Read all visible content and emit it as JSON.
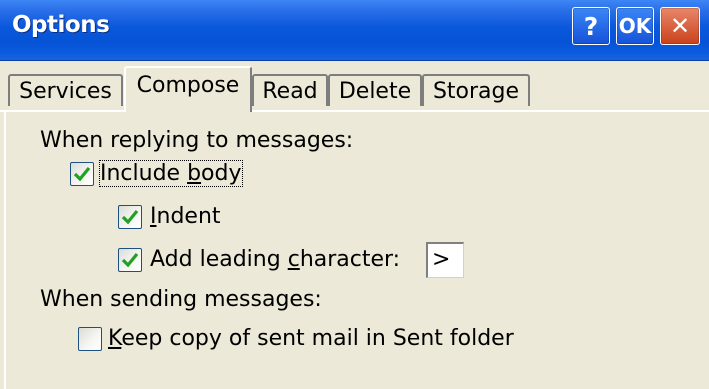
{
  "window": {
    "title": "Options",
    "buttons": {
      "help": "?",
      "ok": "OK",
      "close": "✕"
    }
  },
  "tabs": [
    {
      "label": "Services",
      "active": false
    },
    {
      "label": "Compose",
      "active": true
    },
    {
      "label": "Read",
      "active": false
    },
    {
      "label": "Delete",
      "active": false
    },
    {
      "label": "Storage",
      "active": false
    }
  ],
  "compose": {
    "reply_heading": "When replying to messages:",
    "include_body": {
      "prefix": "Include ",
      "accel": "b",
      "suffix": "ody",
      "checked": true
    },
    "indent": {
      "prefix": "",
      "accel": "I",
      "suffix": "ndent",
      "checked": true
    },
    "leading_char": {
      "prefix": "Add leading ",
      "accel": "c",
      "suffix": "haracter:",
      "checked": true,
      "value": ">"
    },
    "send_heading": "When sending messages:",
    "keep_copy": {
      "prefix": "",
      "accel": "K",
      "suffix": "eep copy of sent mail in Sent folder",
      "checked": false
    }
  },
  "colors": {
    "check": "#21a121",
    "titlebar": "#0a58dc"
  }
}
